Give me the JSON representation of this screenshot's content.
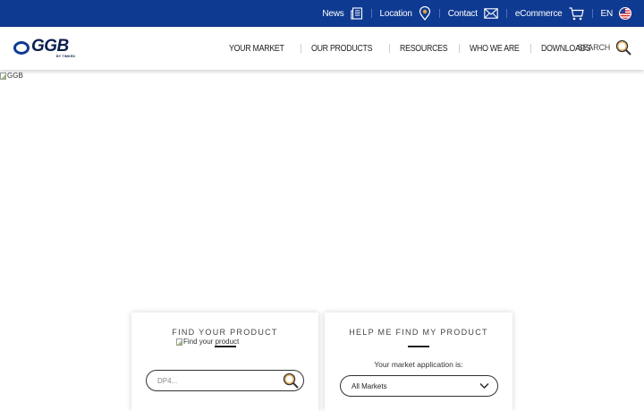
{
  "topbar": {
    "items": [
      {
        "label": "News",
        "icon": "newspaper-icon"
      },
      {
        "label": "Location",
        "icon": "map-pin-icon"
      },
      {
        "label": "Contact",
        "icon": "envelope-icon"
      },
      {
        "label": "eCommerce",
        "icon": "cart-icon"
      },
      {
        "label": "EN",
        "icon": "us-flag-icon"
      }
    ],
    "background_color": "#0f3a92"
  },
  "header": {
    "logo_text": "GGB",
    "logo_subtext": "BY TIMKEN",
    "nav": [
      "YOUR MARKET",
      "OUR PRODUCTS",
      "RESOURCES",
      "WHO WE ARE",
      "DOWNLOADS"
    ],
    "search_label": "SEARCH"
  },
  "hero": {
    "image_alt": "GGB"
  },
  "cards": {
    "find_product": {
      "title": "FIND YOUR PRODUCT",
      "image_alt": "Find your product",
      "input_placeholder": "DP4..."
    },
    "help_me": {
      "title": "HELP ME FIND MY PRODUCT",
      "prompt": "Your market application is:",
      "select_value": "All Markets"
    }
  }
}
